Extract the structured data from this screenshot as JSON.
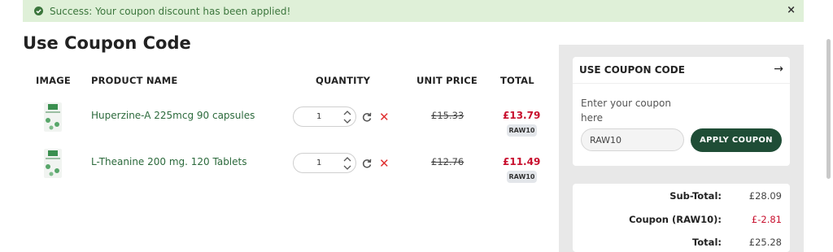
{
  "alert": {
    "text": "Success: Your coupon discount has been applied!",
    "close": "×",
    "icon": "check-circle-icon",
    "color": "#dff0d8"
  },
  "page": {
    "title": "Use Coupon Code"
  },
  "table": {
    "headers": {
      "image": "IMAGE",
      "name": "PRODUCT NAME",
      "quantity": "QUANTITY",
      "unit_price": "UNIT PRICE",
      "total": "TOTAL"
    },
    "rows": [
      {
        "name": "Huperzine-A 225mcg 90 capsules",
        "quantity": "1",
        "unit_price": "£15.33",
        "total": "£13.79",
        "badge": "RAW10"
      },
      {
        "name": "L-Theanine 200 mg. 120 Tablets",
        "quantity": "1",
        "unit_price": "£12.76",
        "total": "£11.49",
        "badge": "RAW10"
      }
    ]
  },
  "coupon_panel": {
    "title": "USE COUPON CODE",
    "label": "Enter your coupon here",
    "input_value": "RAW10",
    "apply_label": "APPLY COUPON",
    "accent": "#1f4d36"
  },
  "totals": {
    "subtotal_label": "Sub-Total:",
    "subtotal_value": "£28.09",
    "coupon_label": "Coupon (RAW10):",
    "coupon_value": "£-2.81",
    "total_label": "Total:",
    "total_value": "£25.28"
  }
}
